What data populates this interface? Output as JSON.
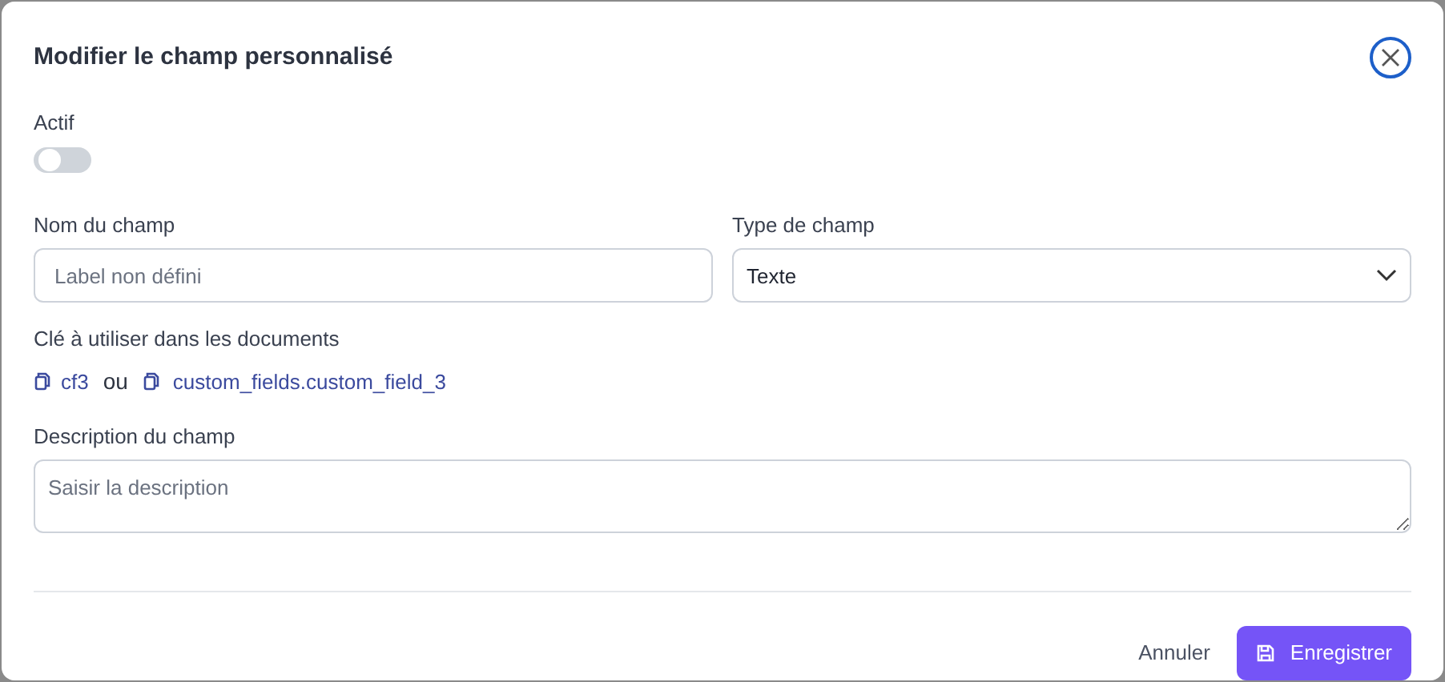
{
  "dialog": {
    "title": "Modifier le champ personnalisé"
  },
  "active": {
    "label": "Actif",
    "on": false
  },
  "name_field": {
    "label": "Nom du champ",
    "placeholder": "Label non défini"
  },
  "type_field": {
    "label": "Type de champ",
    "value": "Texte"
  },
  "keys": {
    "label": "Clé à utiliser dans les documents",
    "short": "cf3",
    "separator": "ou",
    "long": "custom_fields.custom_field_3"
  },
  "description": {
    "label": "Description du champ",
    "placeholder": "Saisir la description"
  },
  "buttons": {
    "cancel": "Annuler",
    "save": "Enregistrer"
  }
}
